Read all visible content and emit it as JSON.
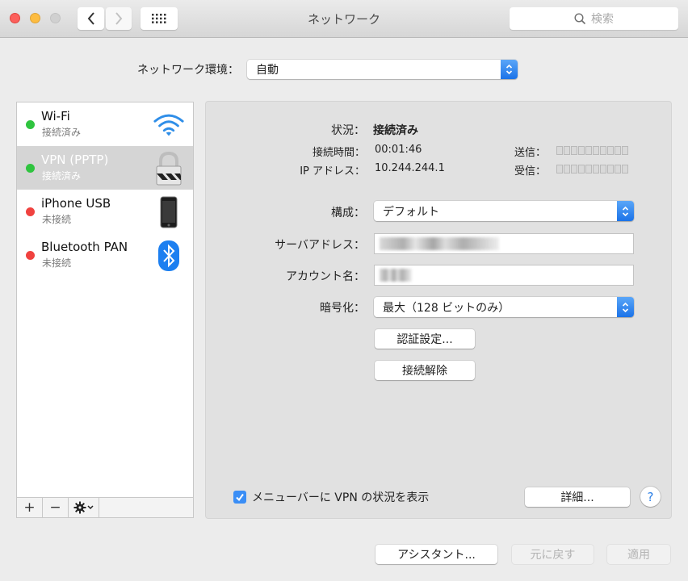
{
  "window": {
    "title": "ネットワーク",
    "search_placeholder": "検索"
  },
  "location": {
    "label": "ネットワーク環境：",
    "value": "自動"
  },
  "services": [
    {
      "name": "Wi-Fi",
      "status": "接続済み",
      "status_color": "#2fc43f",
      "icon": "wifi-icon",
      "selected": false
    },
    {
      "name": "VPN (PPTP)",
      "status": "接続済み",
      "status_color": "#2fc43f",
      "icon": "lock-icon",
      "selected": true
    },
    {
      "name": "iPhone USB",
      "status": "未接続",
      "status_color": "#f0423f",
      "icon": "iphone-icon",
      "selected": false
    },
    {
      "name": "Bluetooth PAN",
      "status": "未接続",
      "status_color": "#f0423f",
      "icon": "bluetooth-icon",
      "selected": false
    }
  ],
  "sidebar_buttons": {
    "add": "+",
    "remove": "−"
  },
  "detail": {
    "status_label": "状況：",
    "status_value": "接続済み",
    "connect_time_label": "接続時間：",
    "connect_time_value": "00:01:46",
    "ip_label": "IP アドレス：",
    "ip_value": "10.244.244.1",
    "sent_label": "送信：",
    "received_label": "受信：",
    "sent_level": 0,
    "received_level": 0,
    "config_label": "構成：",
    "config_value": "デフォルト",
    "server_label": "サーバアドレス：",
    "account_label": "アカウント名：",
    "encryption_label": "暗号化：",
    "encryption_value": "最大（128 ビットのみ）",
    "auth_button": "認証設定...",
    "disconnect_button": "接続解除",
    "show_in_menubar_label": "メニューバーに VPN の状況を表示",
    "show_in_menubar_checked": true,
    "advanced_button": "詳細...",
    "help_button": "?"
  },
  "footer": {
    "assistant_button": "アシスタント...",
    "revert_button": "元に戻す",
    "apply_button": "適用"
  }
}
